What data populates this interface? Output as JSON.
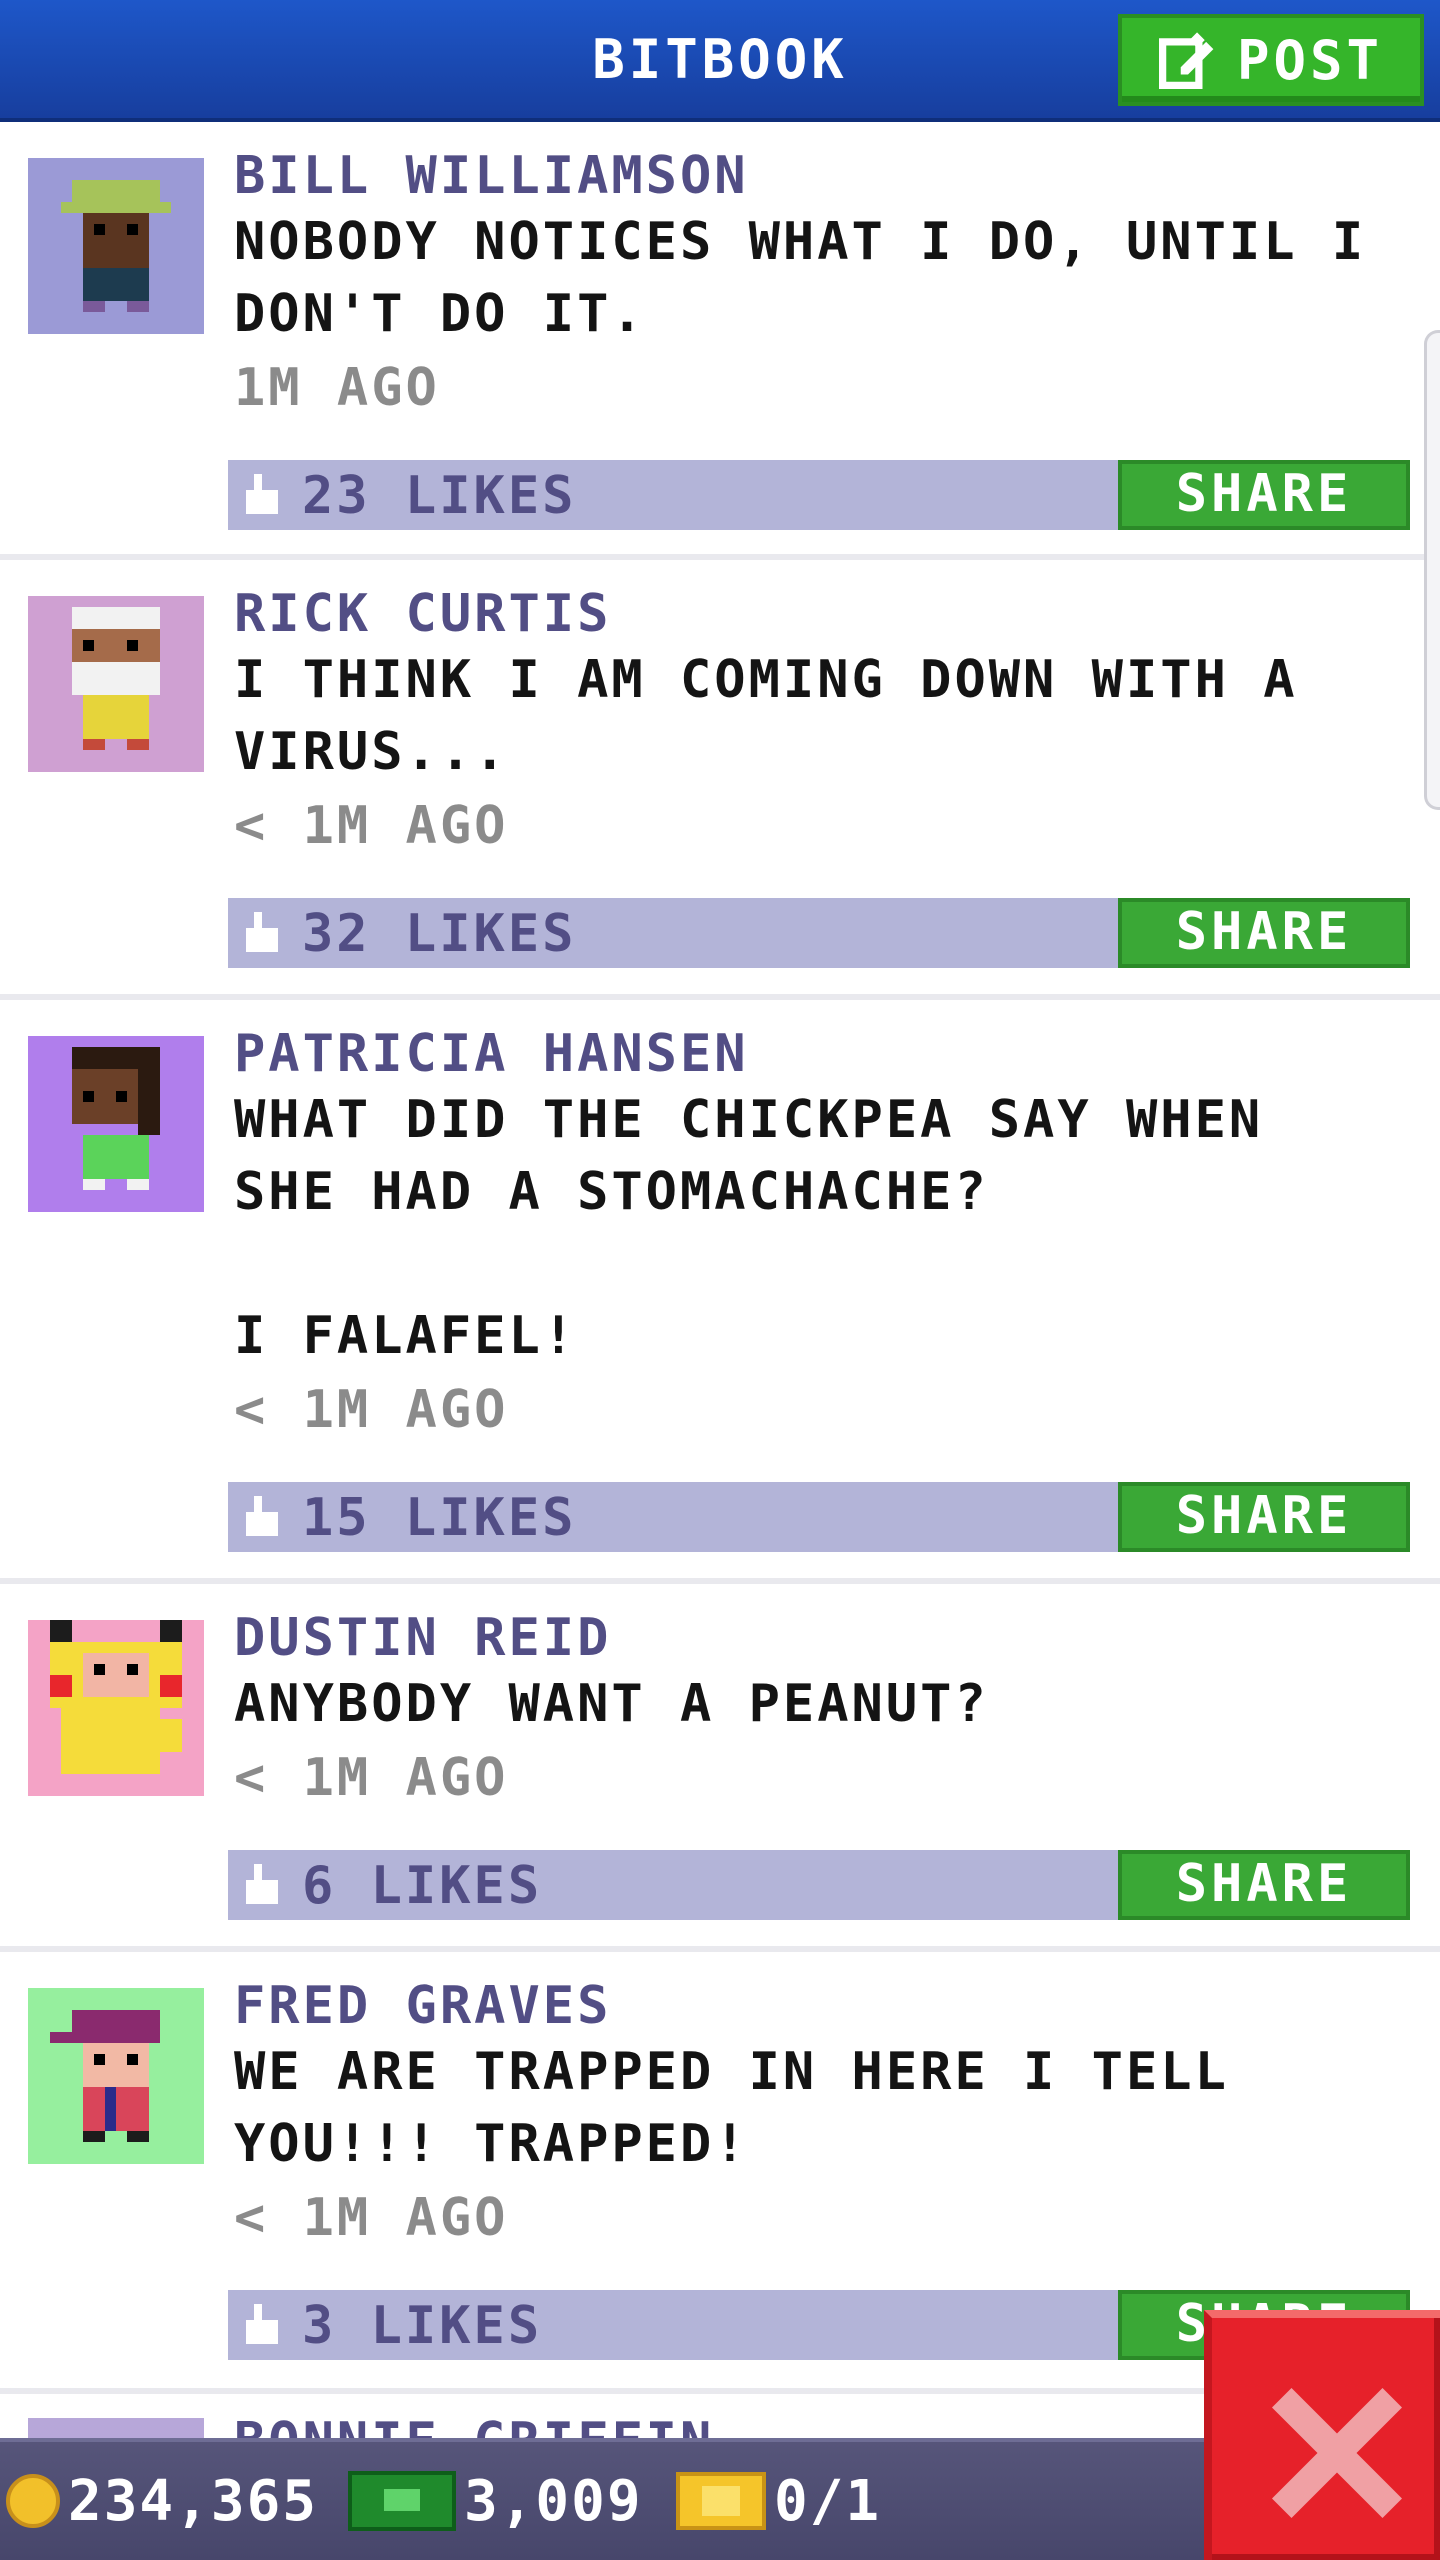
{
  "header": {
    "title": "BITBOOK",
    "post_label": "POST"
  },
  "share_label": "SHARE",
  "posts": [
    {
      "author": "BILL WILLIAMSON",
      "text": "NOBODY NOTICES WHAT I DO, UNTIL I DON'T DO IT.",
      "time": "1M AGO",
      "likes": "23 LIKES",
      "avatar_bg": "#9b9ad6"
    },
    {
      "author": "RICK CURTIS",
      "text": "I THINK I AM COMING DOWN WITH A VIRUS...",
      "time": "< 1M AGO",
      "likes": "32 LIKES",
      "avatar_bg": "#cfa0d2"
    },
    {
      "author": "PATRICIA HANSEN",
      "text": "WHAT DID THE CHICKPEA SAY WHEN SHE HAD A STOMACHACHE?\n\nI FALAFEL!",
      "time": "< 1M AGO",
      "likes": "15 LIKES",
      "avatar_bg": "#b07eec"
    },
    {
      "author": "DUSTIN REID",
      "text": "ANYBODY WANT A PEANUT?",
      "time": "< 1M AGO",
      "likes": "6 LIKES",
      "avatar_bg": "#f4a3c6"
    },
    {
      "author": "FRED GRAVES",
      "text": "WE ARE TRAPPED IN HERE I TELL YOU!!! TRAPPED!",
      "time": "< 1M AGO",
      "likes": "3 LIKES",
      "avatar_bg": "#96ef9e"
    }
  ],
  "next_post": {
    "author": "BONNIE GRIFFIN"
  },
  "status": {
    "coins": "234,365",
    "bux": "3,009",
    "tickets": "0/1"
  },
  "colors": {
    "header_blue": "#1e57c9",
    "share_green": "#3aa836",
    "like_bar": "#b3b4d8",
    "name_purple": "#524e85",
    "close_red": "#e6212a"
  }
}
